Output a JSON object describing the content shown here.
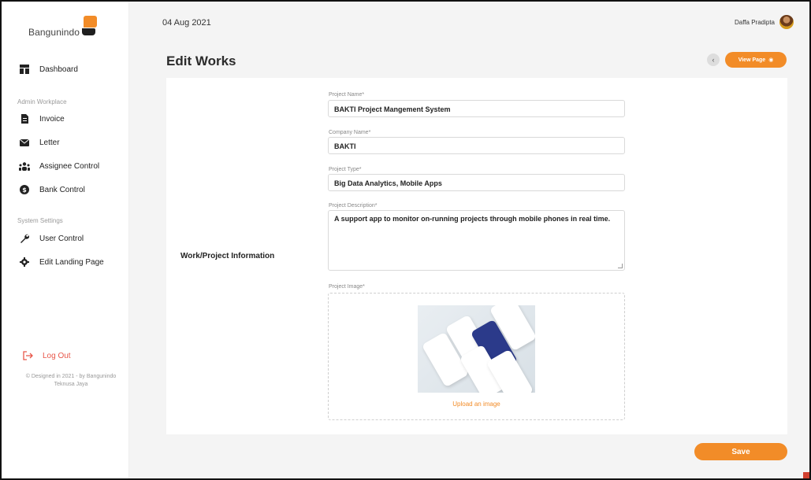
{
  "brand": {
    "name": "Bangunindo",
    "orange": "#f28c28",
    "dark": "#1f1f1f"
  },
  "sidebar": {
    "items": [
      {
        "label": "Dashboard",
        "icon": "dashboard-icon"
      }
    ],
    "admin_section": "Admin Workplace",
    "admin_items": [
      {
        "label": "Invoice",
        "icon": "document-icon"
      },
      {
        "label": "Letter",
        "icon": "envelope-icon"
      },
      {
        "label": "Assignee Control",
        "icon": "users-icon"
      },
      {
        "label": "Bank Control",
        "icon": "bank-icon"
      }
    ],
    "system_section": "System Settings",
    "system_items": [
      {
        "label": "User Control",
        "icon": "wrench-icon"
      },
      {
        "label": "Edit Landing Page",
        "icon": "gear-icon"
      }
    ],
    "logout": {
      "label": "Log Out",
      "icon": "logout-icon",
      "color": "#e8574a"
    },
    "copyright": "© Designed in 2021 - by Bangunindo Teknusa Jaya"
  },
  "topbar": {
    "date": "04 Aug 2021",
    "user_name": "Daffa Pradipta"
  },
  "page": {
    "title": "Edit Works",
    "view_page_label": "View Page",
    "back_icon": "chevron-left-icon",
    "view_icon": "eye-icon"
  },
  "form": {
    "section_title": "Work/Project Information",
    "project_name": {
      "label": "Project Name*",
      "value": "BAKTI Project Mangement System"
    },
    "company_name": {
      "label": "Company Name*",
      "value": "BAKTI"
    },
    "project_type": {
      "label": "Project Type*",
      "value": "Big Data Analytics, Mobile Apps"
    },
    "project_description": {
      "label": "Project Description*",
      "value": "A support app to monitor on-running projects through mobile phones in real time."
    },
    "project_image": {
      "label": "Project Image*",
      "upload_label": "Upload an image"
    },
    "save_label": "Save"
  }
}
